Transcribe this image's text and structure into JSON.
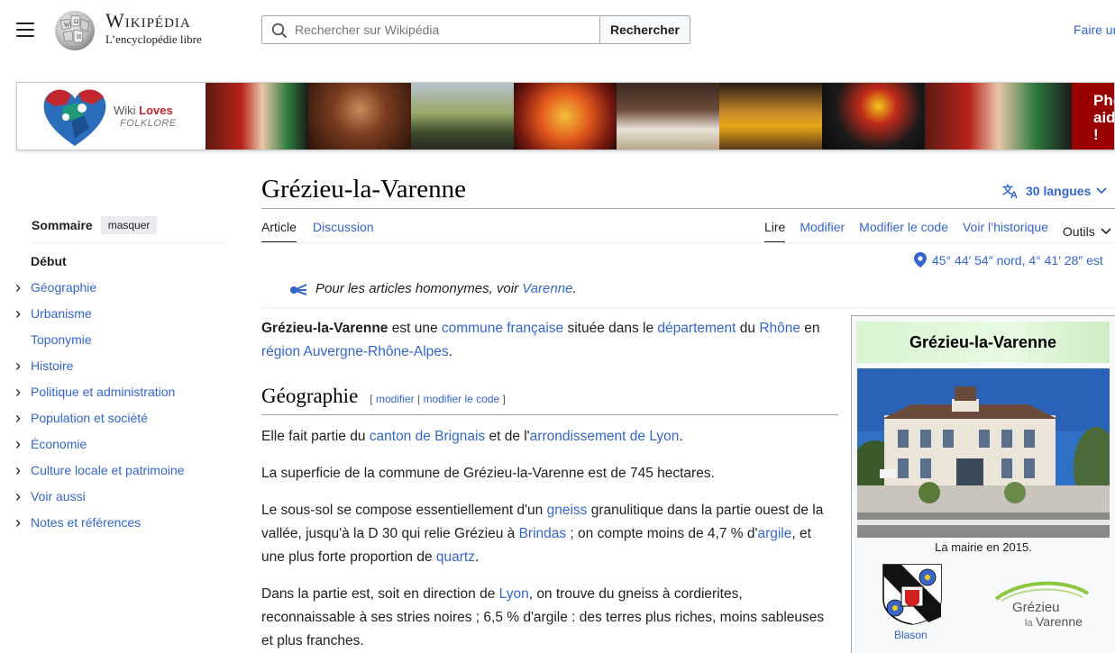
{
  "header": {
    "menu_icon": "hamburger-icon",
    "wordmark_title": "Wikipédia",
    "wordmark_tagline": "L’encyclopédie libre",
    "search_placeholder": "Rechercher sur Wikipédia",
    "search_button": "Rechercher",
    "right_link": "Faire un"
  },
  "banner": {
    "brand_line1_a": "Wiki ",
    "brand_line1_b": "Loves",
    "brand_line2": "FOLKLORE",
    "cta_text": "Pho aide !"
  },
  "toc": {
    "title": "Sommaire",
    "hide_label": "masquer",
    "items": [
      {
        "label": "Début",
        "has_chevron": false
      },
      {
        "label": "Géographie",
        "has_chevron": true
      },
      {
        "label": "Urbanisme",
        "has_chevron": true
      },
      {
        "label": "Toponymie",
        "has_chevron": false
      },
      {
        "label": "Histoire",
        "has_chevron": true
      },
      {
        "label": "Politique et administration",
        "has_chevron": true
      },
      {
        "label": "Population et société",
        "has_chevron": true
      },
      {
        "label": "Économie",
        "has_chevron": true
      },
      {
        "label": "Culture locale et patrimoine",
        "has_chevron": true
      },
      {
        "label": "Voir aussi",
        "has_chevron": true
      },
      {
        "label": "Notes et références",
        "has_chevron": true
      }
    ]
  },
  "article": {
    "title": "Grézieu-la-Varenne",
    "languages": "30 langues",
    "tabs_left": [
      "Article",
      "Discussion"
    ],
    "tabs_right": [
      "Lire",
      "Modifier",
      "Modifier le code",
      "Voir l’historique",
      "Outils"
    ],
    "coordinates": "45° 44′ 54″ nord, 4° 41′ 28″ est",
    "hatnote_prefix": "Pour les articles homonymes, voir ",
    "hatnote_link": "Varenne",
    "hatnote_suffix": ".",
    "intro": {
      "bold": "Grézieu-la-Varenne",
      "t1": " est une ",
      "l1": "commune française",
      "t2": " située dans le ",
      "l2": "département",
      "t3": " du ",
      "l3": "Rhône",
      "t4": " en ",
      "l4": "région Auvergne-Rhône-Alpes",
      "t5": "."
    },
    "section_geo": {
      "heading": "Géographie",
      "edit_open": "[ ",
      "edit_modifier": "modifier",
      "edit_sep": " | ",
      "edit_code": "modifier le code",
      "edit_close": " ]"
    },
    "p1": {
      "t1": "Elle fait partie du ",
      "l1": "canton de Brignais",
      "t2": " et de l'",
      "l2": "arrondissement de Lyon",
      "t3": "."
    },
    "p2": "La superficie de la commune de Grézieu-la-Varenne est de 745 hectares.",
    "p3": {
      "t1": "Le sous-sol se compose essentiellement d'un ",
      "l1": "gneiss",
      "t2": " granulitique dans la partie ouest de la vallée, jusqu'à la D 30 qui relie Grézieu à ",
      "l2": "Brindas",
      "t3": " ; on compte moins de 4,7 % d'",
      "l3": "argile",
      "t4": ", et une plus forte proportion de ",
      "l4": "quartz",
      "t5": "."
    },
    "p4": {
      "t1": "Dans la partie est, soit en direction de ",
      "l1": "Lyon",
      "t2": ", on trouve du gneiss à cordierites, reconnaissable à ses stries noires ; 6,5 % d'argile : des terres plus riches, moins sableuses et plus franches."
    }
  },
  "infobox": {
    "title": "Grézieu-la-Varenne",
    "caption": "La mairie en 2015.",
    "blason_label": "Blason",
    "logo_line1": "Grézieu",
    "logo_line2a": "la",
    "logo_line2b": "Varenne"
  },
  "colors": {
    "link": "#3366cc",
    "text": "#202122",
    "cta_bg": "#9b0000",
    "infobox_header": "#d8f5d0"
  }
}
